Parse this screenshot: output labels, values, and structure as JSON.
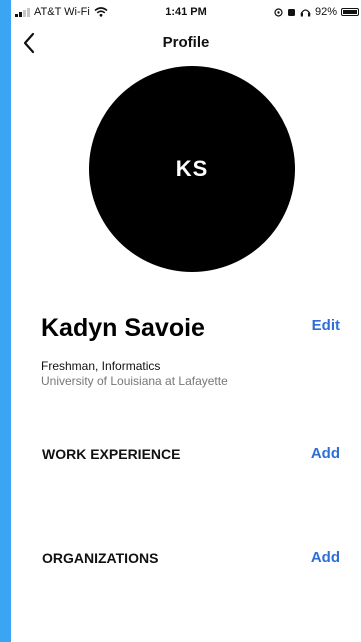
{
  "status_bar": {
    "carrier": "AT&T Wi-Fi",
    "time": "1:41 PM",
    "battery_percent": "92%"
  },
  "nav": {
    "title": "Profile"
  },
  "profile": {
    "initials": "KS",
    "name": "Kadyn Savoie",
    "edit_label": "Edit",
    "standing_major": "Freshman, Informatics",
    "university": "University of Louisiana at Lafayette"
  },
  "sections": {
    "work_experience": {
      "title": "WORK EXPERIENCE",
      "action": "Add"
    },
    "organizations": {
      "title": "ORGANIZATIONS",
      "action": "Add"
    }
  },
  "icons": {
    "back": "chevron-left-icon",
    "wifi": "wifi-icon",
    "battery": "battery-icon"
  },
  "colors": {
    "accent": "#2d6fd6",
    "background_outer": "#3aa6f3",
    "avatar": "#000000"
  }
}
